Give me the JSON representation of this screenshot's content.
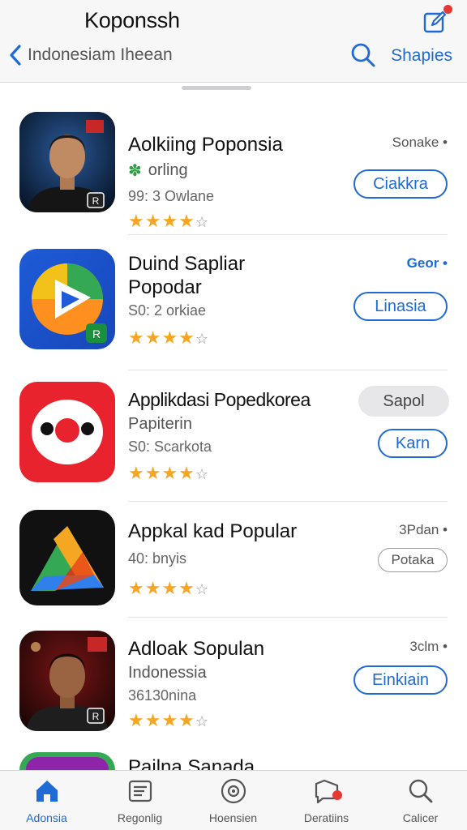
{
  "header": {
    "title": "Koponssh",
    "back_label": "Indonesiam Iheean",
    "share_label": "Shapies",
    "compose_icon": "compose-icon",
    "search_icon": "search-icon"
  },
  "apps": [
    {
      "title": "Aolkiing Poponsia",
      "subtitle": "orling",
      "meta": "99: 3 Owlane",
      "status": "Sonake •",
      "action": "Ciakkra",
      "rating": 4,
      "icon": "portrait-man-icon"
    },
    {
      "title": "Duind Sapliar",
      "title2": "Popodar",
      "meta": "S0: 2 orkiae",
      "status": "Geor •",
      "action": "Linasia",
      "rating": 4,
      "icon": "play-arrow-icon"
    },
    {
      "title": "Applikdasi Popedkorea",
      "subtitle": "Papiterin",
      "meta": "S0: Scarkota",
      "pill": "Sapol",
      "action": "Karn",
      "rating": 4,
      "icon": "red-face-icon"
    },
    {
      "title": "Appkal kad Popular",
      "meta": "40: bnyis",
      "status": "3Pdan •",
      "action": "Potaka",
      "rating": 4,
      "icon": "triangle-drive-icon"
    },
    {
      "title": "Adloak Sopulan",
      "subtitle": "Indonessia",
      "meta": "36130nina",
      "status": "3clm •",
      "action": "Einkiain",
      "rating": 4,
      "icon": "portrait-man-icon"
    },
    {
      "title": "Pailna Sanada",
      "icon": "purple-app-icon"
    }
  ],
  "tabs": [
    {
      "label": "Adonsia",
      "icon": "home-icon",
      "active": true
    },
    {
      "label": "Regonlig",
      "icon": "list-icon"
    },
    {
      "label": "Hoensien",
      "icon": "disc-icon"
    },
    {
      "label": "Deratiins",
      "icon": "chat-icon"
    },
    {
      "label": "Calicer",
      "icon": "search-icon"
    }
  ],
  "colors": {
    "accent": "#1e6ad6",
    "star": "#f5a623",
    "badge": "#e53935"
  }
}
